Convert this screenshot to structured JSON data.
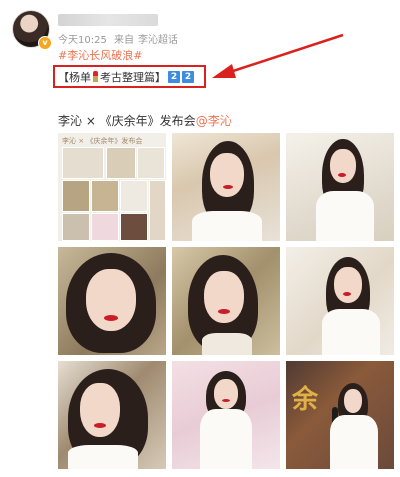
{
  "post": {
    "time": "今天10:25",
    "source_prefix": "来自",
    "source": "李沁超话",
    "hashtag": "#李沁长风破浪#",
    "boxed_text_left": "【杨单",
    "boxed_text_right": "考古整理篇】",
    "boxed_numbers": [
      "2",
      "2"
    ],
    "text_prefix": "李沁 × 《庆余年》发布会",
    "mention": "@李沁"
  },
  "thumbnail_header": "李沁 × 《庆余年》发布会",
  "colors": {
    "accent": "#eb7350",
    "highlight_box": "#d9221e",
    "number_badge": "#3e8ce0",
    "verified_badge": "#f5a623"
  },
  "icons": {
    "verified": "v-badge-icon",
    "lipstick": "lipstick-emoji-icon"
  },
  "gold_characters": [
    "余"
  ]
}
